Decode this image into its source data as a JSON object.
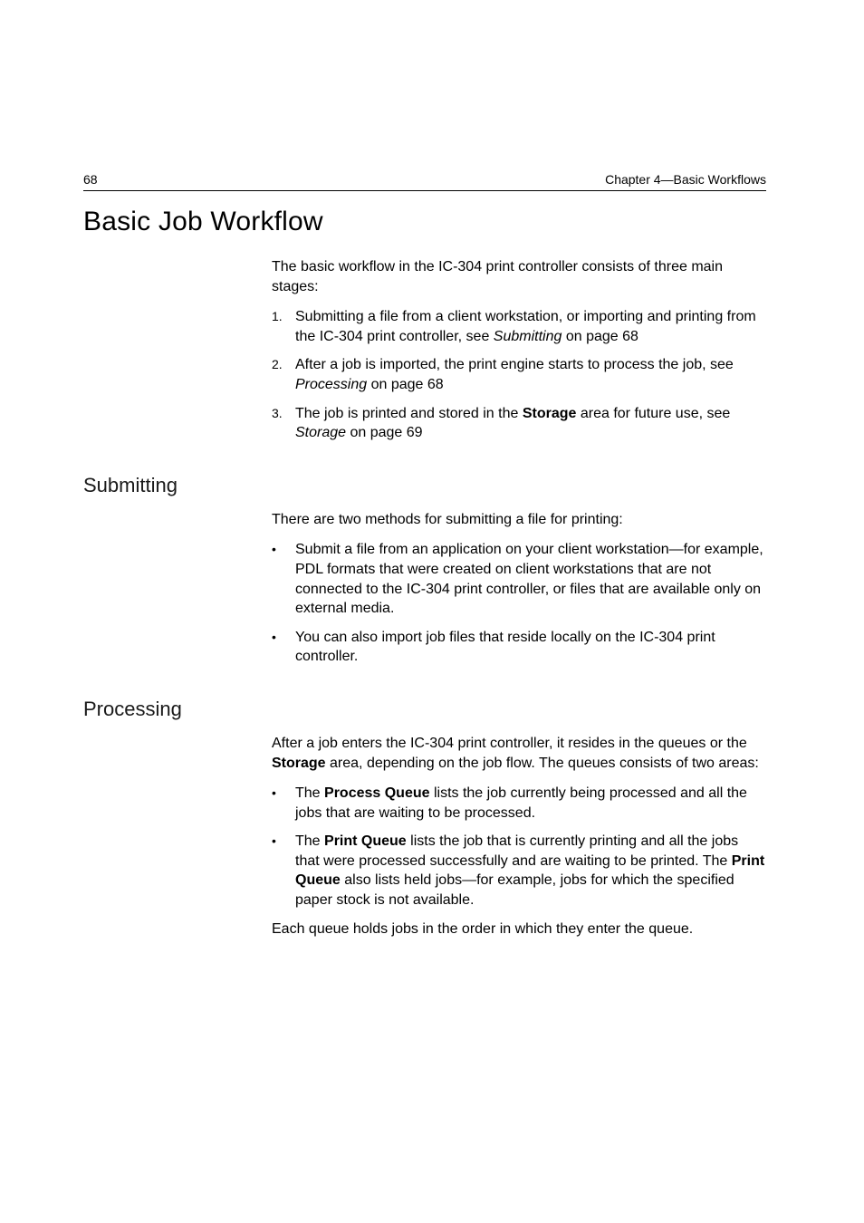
{
  "header": {
    "page_number": "68",
    "chapter_label": "Chapter 4—Basic Workflows"
  },
  "h1": "Basic Job Workflow",
  "intro_para": "The basic workflow in the IC-304 print controller consists of three main stages:",
  "steps": [
    {
      "marker": "1.",
      "pre": "Submitting a file from a client workstation, or importing and printing from the IC-304 print controller, see ",
      "link": "Submitting",
      "post": " on page 68"
    },
    {
      "marker": "2.",
      "pre": "After a job is imported, the print engine starts to process the job, see ",
      "link": "Processing",
      "post": " on page 68"
    },
    {
      "marker": "3.",
      "pre": "The job is printed and stored in the ",
      "bold": "Storage",
      "mid": " area for future use, see ",
      "link": "Storage",
      "post": " on page 69"
    }
  ],
  "submitting": {
    "heading": "Submitting",
    "para": "There are two methods for submitting a file for printing:",
    "bullets": [
      "Submit a file from an application on your client workstation—for example, PDL formats that were created on client workstations that are not connected to the IC-304 print controller, or files that are available only on external media.",
      "You can also import job files that reside locally on the IC-304 print controller."
    ]
  },
  "processing": {
    "heading": "Processing",
    "para_pre": "After a job enters the IC-304 print controller, it resides in the queues or the ",
    "para_bold": "Storage",
    "para_post": " area, depending on the job flow. The queues consists of two areas:",
    "bullets": [
      {
        "pre": "The ",
        "bold": "Process Queue",
        "post": " lists the job currently being processed and all the jobs that are waiting to be processed."
      },
      {
        "pre": "The ",
        "bold": "Print Queue",
        "mid": " lists the job that is currently printing and all the jobs that were processed successfully and are waiting to be printed. The ",
        "bold2": "Print Queue",
        "post": " also lists held jobs—for example, jobs for which the specified paper stock is not available."
      }
    ],
    "closing": "Each queue holds jobs in the order in which they enter the queue."
  }
}
